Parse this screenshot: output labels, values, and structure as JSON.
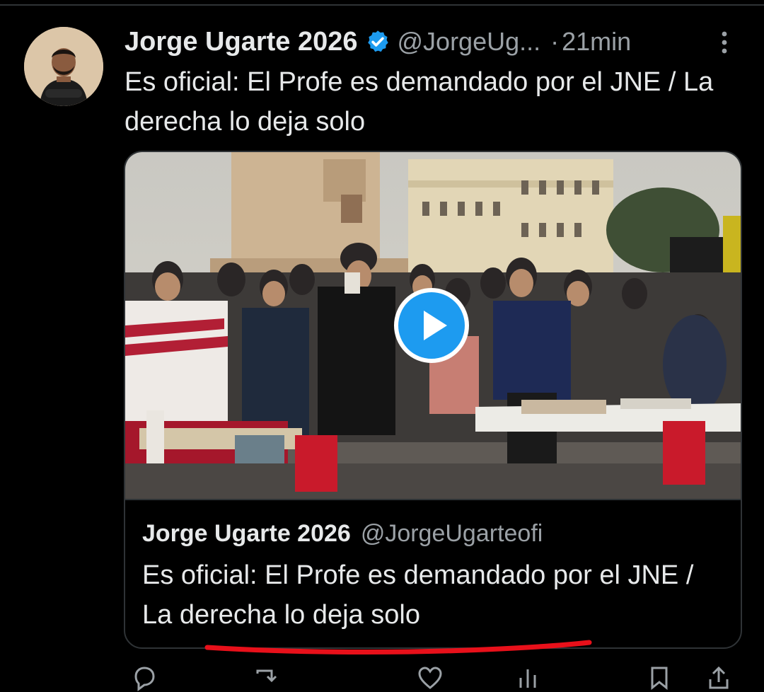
{
  "tweet": {
    "author_name": "Jorge Ugarte 2026",
    "handle": "@JorgeUg...",
    "separator": "·",
    "time": "21min",
    "text": "Es oficial: El Profe es demandado por el JNE / La derecha lo deja solo",
    "avatar_icon": "person-avatar",
    "verified_icon": "verified-badge-icon",
    "more_icon": "more-vertical-icon"
  },
  "quoted": {
    "author_name": "Jorge Ugarte 2026",
    "handle": "@JorgeUgarteofi",
    "text": "Es oficial: El Profe es demandado por el JNE / La derecha lo deja solo"
  },
  "media": {
    "type": "video",
    "play_icon": "play-icon"
  },
  "actions": [
    {
      "name": "reply",
      "icon": "reply-icon"
    },
    {
      "name": "retweet",
      "icon": "retweet-icon"
    },
    {
      "name": "like",
      "icon": "heart-icon"
    },
    {
      "name": "views",
      "icon": "views-icon"
    },
    {
      "name": "bookmark",
      "icon": "bookmark-icon"
    },
    {
      "name": "share",
      "icon": "share-icon"
    }
  ],
  "colors": {
    "background": "#000000",
    "text": "#e7e9ea",
    "muted": "#9ba1a6",
    "verified": "#1d9bf0",
    "play": "#1d9bf0",
    "annotation": "#e8101a"
  }
}
